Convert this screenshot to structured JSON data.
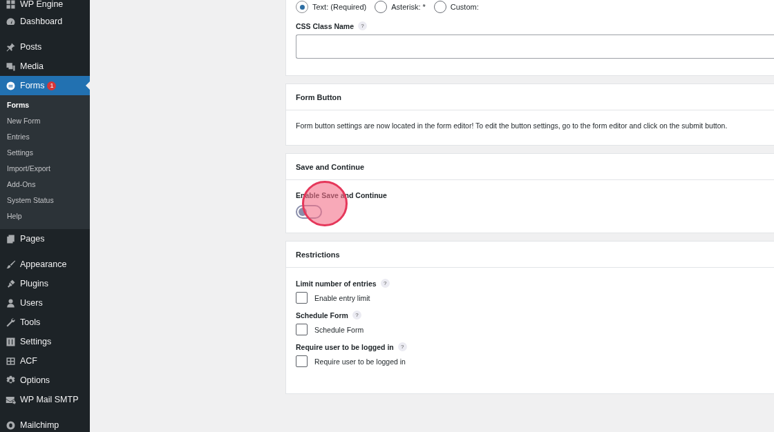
{
  "sidebar": {
    "groups": [
      [
        {
          "label": "WP Engine",
          "selected": false
        },
        {
          "label": "Dashboard",
          "selected": false
        }
      ],
      [
        {
          "label": "Posts",
          "selected": false
        },
        {
          "label": "Media",
          "selected": false
        },
        {
          "label": "Forms",
          "selected": true,
          "badge": "1",
          "children": [
            {
              "label": "Forms",
              "selected": true
            },
            {
              "label": "New Form",
              "selected": false
            },
            {
              "label": "Entries",
              "selected": false
            },
            {
              "label": "Settings",
              "selected": false
            },
            {
              "label": "Import/Export",
              "selected": false
            },
            {
              "label": "Add-Ons",
              "selected": false
            },
            {
              "label": "System Status",
              "selected": false
            },
            {
              "label": "Help",
              "selected": false
            }
          ]
        },
        {
          "label": "Pages",
          "selected": false
        }
      ],
      [
        {
          "label": "Appearance",
          "selected": false
        },
        {
          "label": "Plugins",
          "selected": false
        },
        {
          "label": "Users",
          "selected": false
        },
        {
          "label": "Tools",
          "selected": false
        },
        {
          "label": "Settings",
          "selected": false
        },
        {
          "label": "ACF",
          "selected": false
        },
        {
          "label": "Options",
          "selected": false
        },
        {
          "label": "WP Mail SMTP",
          "selected": false
        }
      ],
      [
        {
          "label": "Mailchimp",
          "selected": false
        }
      ]
    ]
  },
  "cards": [
    {
      "kind": "field-settings",
      "radios": [
        {
          "label": "Text: (Required)",
          "selected": true
        },
        {
          "label": "Asterisk: *",
          "selected": false
        },
        {
          "label": "Custom:",
          "selected": false
        }
      ],
      "field": {
        "label": "CSS Class Name",
        "help": "?"
      }
    },
    {
      "kind": "notice",
      "title": "Form Button",
      "text": "Form button settings are now located in the form editor! To edit the button settings, go to the form editor and click on the submit button."
    },
    {
      "kind": "toggle",
      "title": "Save and Continue",
      "label": "Enable Save and Continue",
      "on": false,
      "click_marker": true
    },
    {
      "kind": "checkboxes",
      "title": "Restrictions",
      "groups": [
        {
          "label": "Limit number of entries",
          "help": "?",
          "option": "Enable entry limit",
          "checked": false
        },
        {
          "label": "Schedule Form",
          "help": "?",
          "option": "Schedule Form",
          "checked": false
        },
        {
          "label": "Require user to be logged in",
          "help": "?",
          "option": "Require user to be logged in",
          "checked": false
        }
      ]
    }
  ]
}
